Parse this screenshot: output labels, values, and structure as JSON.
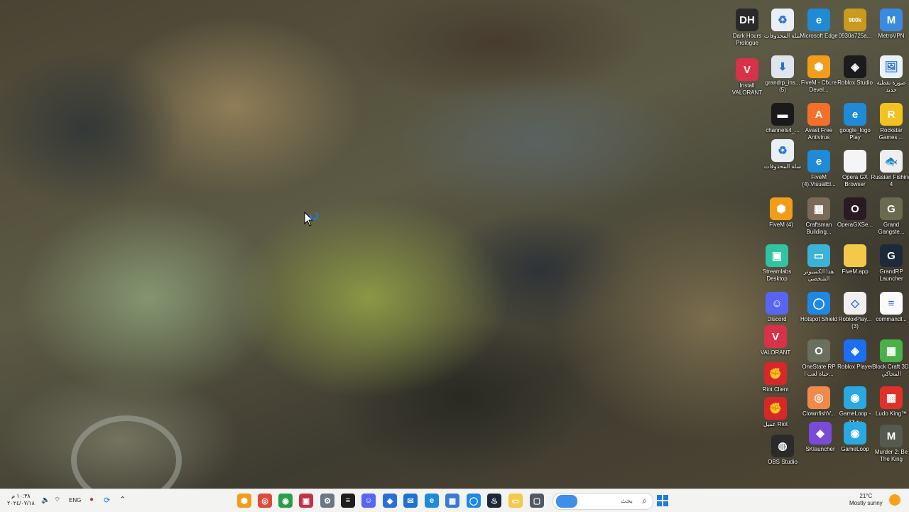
{
  "desktop": {
    "icons": [
      {
        "label": "Dark Hours Prologue",
        "icon": "dark-hours-icon",
        "color": "#2a2a2a",
        "glyph": "DH"
      },
      {
        "label": "سلة المحذوفات",
        "icon": "recycle-bin-icon",
        "color": "#e8f0f6",
        "glyph": "♻"
      },
      {
        "label": "Microsoft Edge",
        "icon": "edge-icon",
        "color": "#1f8ad6",
        "glyph": "e"
      },
      {
        "label": "0930a725a...",
        "icon": "image-file-icon",
        "color": "#c99a1d",
        "glyph": "900k"
      },
      {
        "label": "MetroVPN",
        "icon": "metrovpn-icon",
        "color": "#3a8be0",
        "glyph": "M"
      },
      {
        "label": "Install VALORANT",
        "icon": "valorant-icon",
        "color": "#d8314a",
        "glyph": "V"
      },
      {
        "label": "grandrp_ins... (5)",
        "icon": "download-icon",
        "color": "#dfe5ea",
        "glyph": "⬇"
      },
      {
        "label": "FiveM - Cfx.re Devel...",
        "icon": "fivem-icon",
        "color": "#f29d1a",
        "glyph": "⬢"
      },
      {
        "label": "Roblox Studio",
        "icon": "roblox-studio-icon",
        "color": "#1b1b1b",
        "glyph": "◈"
      },
      {
        "label": "صورة نقطية جديد",
        "icon": "bitmap-file-icon",
        "color": "#e9f2fb",
        "glyph": "🖼"
      },
      {
        "label": "channels4_...",
        "icon": "image-thumb-icon",
        "color": "#1a1a1a",
        "glyph": "▬"
      },
      {
        "label": "Avast Free Antivirus",
        "icon": "avast-icon",
        "color": "#f2702a",
        "glyph": "A"
      },
      {
        "label": "google_logo Play",
        "icon": "edge-html-icon",
        "color": "#1f8ad6",
        "glyph": "e"
      },
      {
        "label": "Rockstar Games ...",
        "icon": "rockstar-icon",
        "color": "#f3c220",
        "glyph": "R"
      },
      {
        "label": "سلة المحذوفات",
        "icon": "recycle-bin-icon",
        "color": "#e8f0f6",
        "glyph": "♻"
      },
      {
        "label": "FiveM (4).VisualEl...",
        "icon": "edge-html-icon",
        "color": "#1f8ad6",
        "glyph": "e"
      },
      {
        "label": "Opera GX Browser",
        "icon": "blank-file-icon",
        "color": "#f5f5f5",
        "glyph": ""
      },
      {
        "label": "Russian Fishing 4",
        "icon": "fishing-icon",
        "color": "#eeeeee",
        "glyph": "🐟"
      },
      {
        "label": "FiveM (4)",
        "icon": "fivem-icon",
        "color": "#f29d1a",
        "glyph": "⬢"
      },
      {
        "label": "Craftsman Building...",
        "icon": "craftsman-icon",
        "color": "#7a6a5a",
        "glyph": "▦"
      },
      {
        "label": "OperaGXSe...",
        "icon": "opera-gx-icon",
        "color": "#2a1a22",
        "glyph": "O"
      },
      {
        "label": "Grand Gangste...",
        "icon": "grand-gangster-icon",
        "color": "#6a6a50",
        "glyph": "G"
      },
      {
        "label": "Streamlabs Desktop",
        "icon": "streamlabs-icon",
        "color": "#31c3a2",
        "glyph": "▣"
      },
      {
        "label": "هذا الكمبيوتر الشخصي",
        "icon": "this-pc-icon",
        "color": "#3bb3d6",
        "glyph": "▭"
      },
      {
        "label": "FiveM.app",
        "icon": "folder-icon",
        "color": "#f3c94a",
        "glyph": ""
      },
      {
        "label": "GrandRP Launcher",
        "icon": "grandrp-icon",
        "color": "#1d2a3a",
        "glyph": "G"
      },
      {
        "label": "Discord",
        "icon": "discord-icon",
        "color": "#5865f2",
        "glyph": "☺"
      },
      {
        "label": "Hotspot Shield",
        "icon": "hotspot-shield-icon",
        "color": "#1e88e5",
        "glyph": "◯"
      },
      {
        "label": "RobloxPlay... (3)",
        "icon": "roblox-file-icon",
        "color": "#f0f0f0",
        "glyph": "◇"
      },
      {
        "label": "commandl...",
        "icon": "text-file-icon",
        "color": "#fafafa",
        "glyph": "≡"
      },
      {
        "label": "VALORANT",
        "icon": "valorant-icon",
        "color": "#d8314a",
        "glyph": "V"
      },
      {
        "label": "OneState RP حياة لعب ا...",
        "icon": "onestate-icon",
        "color": "#6a7060",
        "glyph": "O"
      },
      {
        "label": "Roblox Player",
        "icon": "roblox-player-icon",
        "color": "#1b6ff0",
        "glyph": "◈"
      },
      {
        "label": "Block Craft 3D: المحاكي",
        "icon": "block-craft-icon",
        "color": "#4ab04a",
        "glyph": "▦"
      },
      {
        "label": "Riot Client",
        "icon": "riot-client-icon",
        "color": "#d8272b",
        "glyph": "✊"
      },
      {
        "label": "ClownfishV...",
        "icon": "clownfish-icon",
        "color": "#f08a4a",
        "glyph": "◎"
      },
      {
        "label": "GameLoop - نسخة",
        "icon": "gameloop-icon",
        "color": "#2aa8e0",
        "glyph": "◉"
      },
      {
        "label": "Ludo King™",
        "icon": "ludo-king-icon",
        "color": "#e0302a",
        "glyph": "▩"
      },
      {
        "label": "عميل Riot",
        "icon": "riot-client-icon",
        "color": "#d8272b",
        "glyph": "✊"
      },
      {
        "label": "SKlauncher",
        "icon": "sklauncher-icon",
        "color": "#7a4bd8",
        "glyph": "◆"
      },
      {
        "label": "GameLoop",
        "icon": "gameloop-icon",
        "color": "#2aa8e0",
        "glyph": "◉"
      },
      {
        "label": "Murder 2: Be The King",
        "icon": "murder-2-icon",
        "color": "#555a50",
        "glyph": "M"
      },
      {
        "label": "OBS Studio",
        "icon": "obs-icon",
        "color": "#2a2a2a",
        "glyph": "◍"
      }
    ]
  },
  "taskbar": {
    "clock_time": "١٠:٣٨ م",
    "clock_date": "٢٠٢٤/٠٧/١٨",
    "language": "ENG",
    "search_placeholder": "بحث",
    "weather_temp": "21°C",
    "weather_text": "Mostly sunny",
    "pinned": [
      {
        "icon": "fivem-taskbar-icon",
        "color": "#f29d1a",
        "glyph": "⬢"
      },
      {
        "icon": "clownfish-taskbar-icon",
        "color": "#e04a3a",
        "glyph": "◎"
      },
      {
        "icon": "chrome-icon",
        "color": "#2a9d4a",
        "glyph": "◉"
      },
      {
        "icon": "app-window-icon",
        "color": "#c0344a",
        "glyph": "▣"
      },
      {
        "icon": "settings-gear-icon",
        "color": "#6b7785",
        "glyph": "⚙"
      },
      {
        "icon": "terminal-icon",
        "color": "#1e1e1e",
        "glyph": "≡"
      },
      {
        "icon": "discord-taskbar-icon",
        "color": "#5865f2",
        "glyph": "☺"
      },
      {
        "icon": "shield-app-icon",
        "color": "#2a6fd6",
        "glyph": "◆"
      },
      {
        "icon": "mail-icon",
        "color": "#1f72d0",
        "glyph": "✉"
      },
      {
        "icon": "edge-taskbar-icon",
        "color": "#1f8ad6",
        "glyph": "e"
      },
      {
        "icon": "store-icon",
        "color": "#3a7ad6",
        "glyph": "▦"
      },
      {
        "icon": "vpn-shield-icon",
        "color": "#1e88e5",
        "glyph": "◯"
      },
      {
        "icon": "steam-icon",
        "color": "#1b2838",
        "glyph": "♨"
      },
      {
        "icon": "file-explorer-icon",
        "color": "#f3c94a",
        "glyph": "▭"
      },
      {
        "icon": "task-view-icon",
        "color": "#505a66",
        "glyph": "▢"
      }
    ]
  }
}
